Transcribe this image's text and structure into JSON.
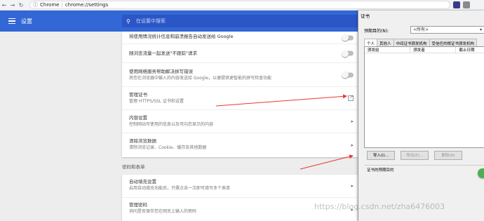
{
  "browser": {
    "app_name": "Chrome",
    "url": "chrome://settings"
  },
  "header": {
    "title": "设置",
    "search_placeholder": "在设置中搜索"
  },
  "rows_top": [
    {
      "title": "将使用情况统计信息和崩溃报告自动发送给 Google",
      "desc": "",
      "control": "toggle"
    },
    {
      "title": "随浏览流量一起发送\"不跟踪\"请求",
      "desc": "",
      "control": "toggle"
    },
    {
      "title": "使用网络服务帮助解决拼写错误",
      "desc": "将您在浏览器中输入的内容发送给 Google，以便提供更智能的拼写检查功能",
      "control": "toggle"
    },
    {
      "title": "管理证书",
      "desc": "管理 HTTPS/SSL 证书和设置",
      "control": "external"
    },
    {
      "title": "内容设置",
      "desc": "控制网站可使用的信息以及可向您显示的内容",
      "control": "arrow"
    },
    {
      "title": "清除浏览数据",
      "desc": "清除浏览记录、Cookie、缓存及其他数据",
      "control": "arrow"
    }
  ],
  "section_passwords": "密码和表单",
  "rows_bottom": [
    {
      "title": "自动填充设置",
      "desc": "启用自动填充功能后，只需点击一次即可填写多个表单",
      "control": "arrow"
    },
    {
      "title": "管理密码",
      "desc": "询问是否保存您在网页上输入的密码",
      "control": "arrow"
    }
  ],
  "dialog": {
    "title": "证书",
    "purpose_label": "预期目的(N):",
    "purpose_value": "<所有>",
    "tabs": [
      "个人",
      "其他人",
      "中间证书颁发机构",
      "受信任的根证书颁发机构"
    ],
    "columns": [
      "颁发给",
      "颁发者",
      "截止日期"
    ],
    "buttons": {
      "import": "导入(I)...",
      "export": "导出(E)...",
      "remove": "删除(R)"
    },
    "group_label": "证书的预期目的"
  },
  "watermark": "https://blog.csdn.net/zha6476003",
  "colors": {
    "header_blue": "#3367d6",
    "arrow_red": "#e53935"
  }
}
